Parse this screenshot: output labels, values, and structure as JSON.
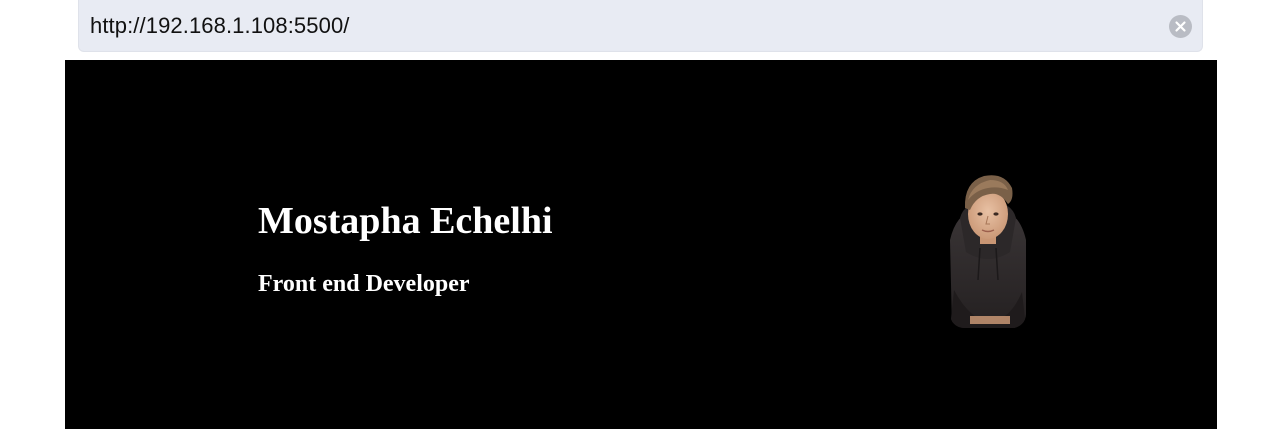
{
  "browser": {
    "address": "http://192.168.1.108:5500/",
    "clear_icon": "clear-icon"
  },
  "hero": {
    "name": "Mostapha Echelhi",
    "role": "Front end Developer",
    "background_color": "#000000",
    "text_color": "#ffffff",
    "avatar_icon": "profile-photo"
  }
}
